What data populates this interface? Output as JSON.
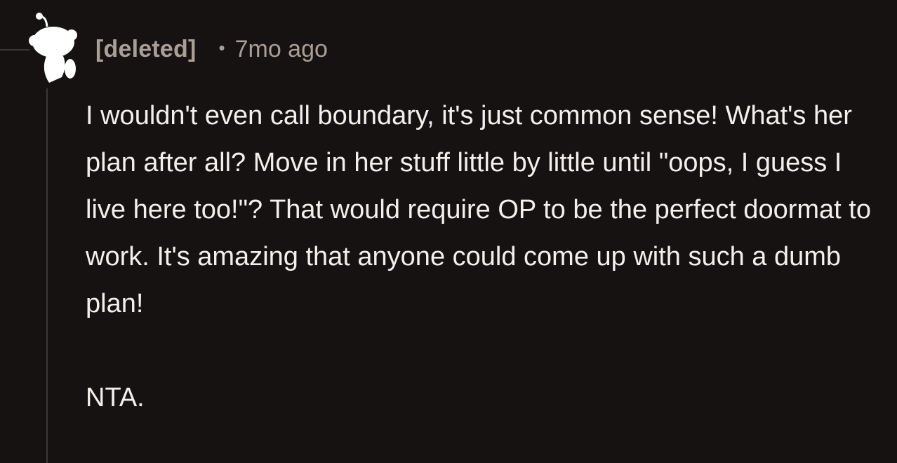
{
  "comment": {
    "author": "[deleted]",
    "separator": "•",
    "timestamp": "7mo ago",
    "avatar_icon": "snoo-avatar-icon",
    "paragraphs": [
      "I wouldn't even call boundary, it's just common sense! What's her plan after all? Move in her stuff little by little until \"oops, I guess I live here too!\"? That would require OP to be the perfect doormat to work. It's amazing that anyone could come up with such a dumb plan!",
      "NTA."
    ]
  },
  "colors": {
    "background": "#161211",
    "meta_text": "#a89f98",
    "body_text": "#f2efed",
    "thread_line": "#3a3736"
  }
}
